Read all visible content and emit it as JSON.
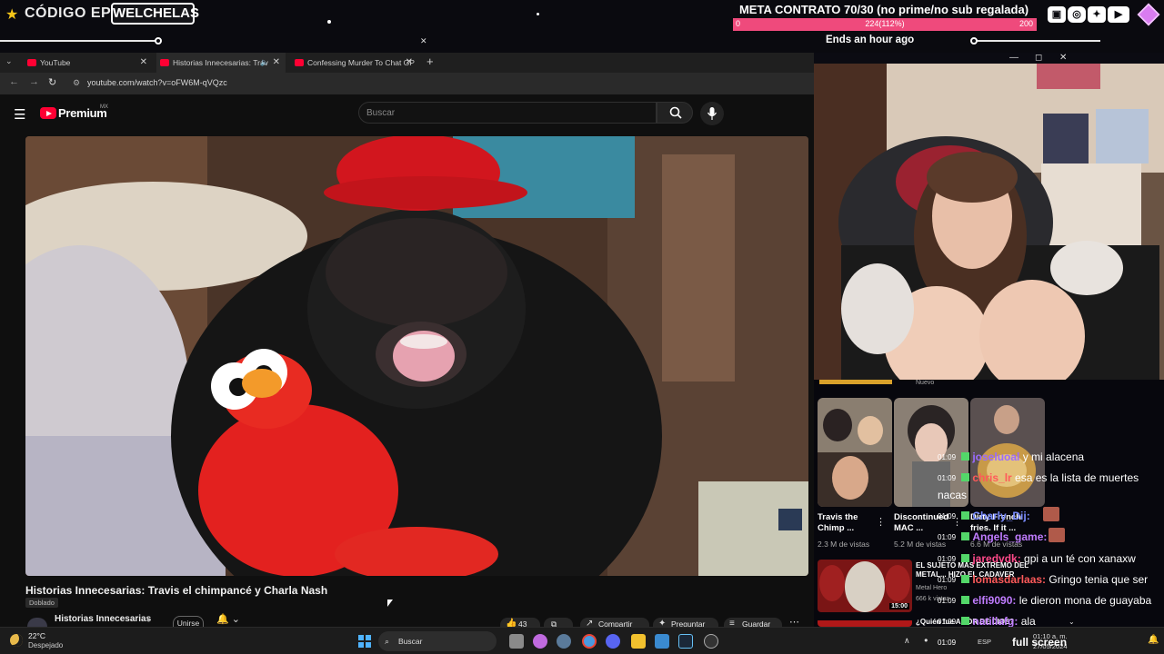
{
  "overlay": {
    "code_label": "CÓDIGO EPIC",
    "code_value": "WELCHELAS",
    "goal_title": "META CONTRATO 70/30 (no prime/no sub regalada)",
    "goal_min": "0",
    "goal_current": "224(112%)",
    "goal_max": "200",
    "goal_ends": "Ends an hour ago",
    "socials": [
      "twitch-icon",
      "instagram-icon",
      "twitter-icon",
      "youtube-icon"
    ],
    "accent": "#ef4a7c"
  },
  "browser": {
    "tabs": [
      {
        "label": "YouTube"
      },
      {
        "label": "Historias Innecesarias: Trav"
      },
      {
        "label": "Confessing Murder To Chat GP"
      }
    ],
    "url": "youtube.com/watch?v=oFW6M-qVQzc"
  },
  "youtube": {
    "brand": "Premium",
    "region": "MX",
    "search_placeholder": "Buscar",
    "video_title": "Historias Innecesarias: Travis el chimpancé y Charla Nash",
    "dubbed_label": "Doblado",
    "channel_name": "Historias Innecesarias",
    "join_label": "Unirse",
    "likes": "43 k",
    "share_label": "Compartir",
    "ask_label": "Preguntar",
    "save_label": "Guardar"
  },
  "sidebar": {
    "badge_label": "Nuevo",
    "shorts": [
      {
        "title": "Travis the Chimp ...",
        "views": "2.3 M de vistas"
      },
      {
        "title": "Discontinued MAC ...",
        "views": "5.2 M de vistas"
      },
      {
        "title": "Dirty French fries. If it ...",
        "views": "6.6 M de vistas"
      }
    ],
    "related": [
      {
        "title": "EL SUJETO MÁS EXTREMO DEL METAL... HIZO EL CADAVER",
        "channel": "Metal Hero",
        "meta": "666 k vistas",
        "duration": "15:00"
      },
      {
        "title": "¿Quién fue AMOR DE DIOS? ¿Es...",
        "channel": "",
        "meta": "",
        "duration": ""
      }
    ]
  },
  "chat": [
    {
      "time": "01:09",
      "user": "joseluoal",
      "msg": "y mi alacena",
      "color": "#9b6bff"
    },
    {
      "time": "01:09",
      "user": "chris_lr",
      "msg": "esa es la lista de muertes",
      "color": "#ff5a5a"
    },
    {
      "time": "",
      "user": "",
      "msg": "nacas",
      "color": "#ffffff"
    },
    {
      "time": "01:09",
      "user": "Charly_Dij:",
      "msg": "",
      "color": "#7a8cff"
    },
    {
      "time": "01:09",
      "user": "Angels_game:",
      "msg": "",
      "color": "#c07cff"
    },
    {
      "time": "01:09",
      "user": "jaredvdk:",
      "msg": "gpi a un té con xanaxw",
      "color": "#ff4a8a"
    },
    {
      "time": "01:09",
      "user": "lomasdarlaas:",
      "msg": "Gringo tenia que ser",
      "color": "#ff5a5a"
    },
    {
      "time": "01:09",
      "user": "elfi9090:",
      "msg": "le dieron mona de guayaba",
      "color": "#c07cff"
    },
    {
      "time": "01:09",
      "user": "natillafg:",
      "msg": "ala",
      "color": "#c07cff"
    },
    {
      "time": "01:09",
      "user": "",
      "msg": "full screen",
      "color": "#ffffff"
    }
  ],
  "taskbar": {
    "temp": "22°C",
    "weather": "Despejado",
    "search_label": "Buscar",
    "lang": "ESP",
    "time": "01:10 a. m.",
    "date": "27/05/2024"
  }
}
